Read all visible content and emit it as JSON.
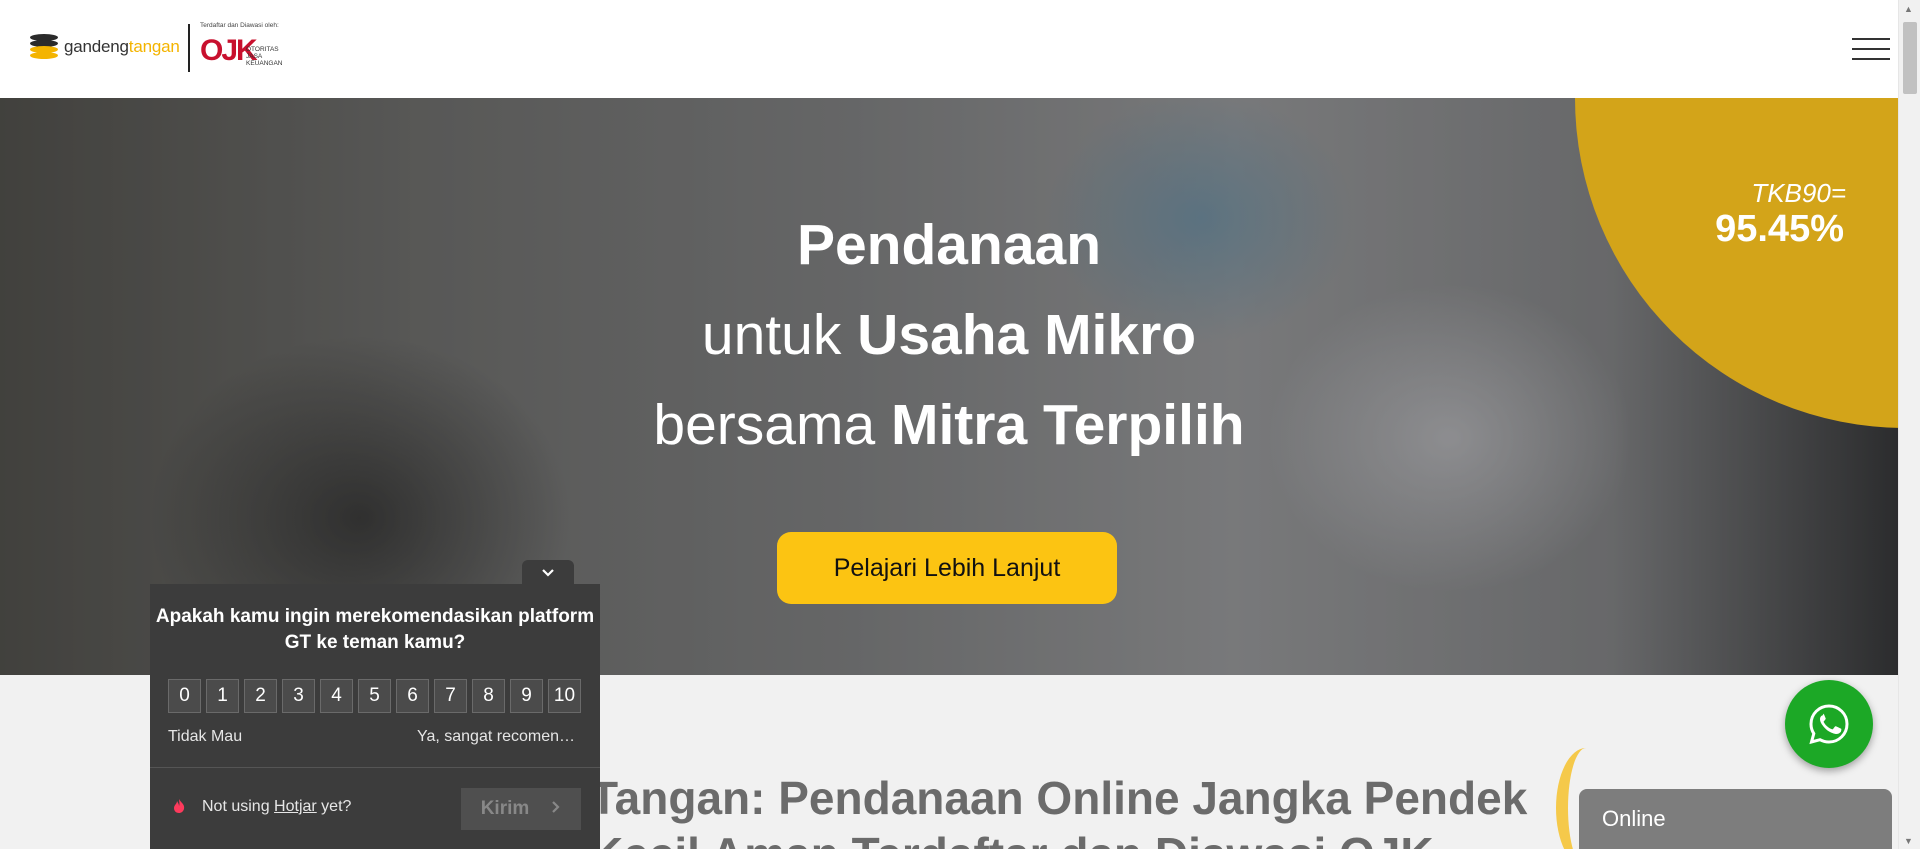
{
  "header": {
    "logo_prefix": "gandeng",
    "logo_suffix": "tangan",
    "ojk_caption": "Terdaftar dan Diawasi oleh:",
    "ojk_mark": "OJK",
    "ojk_line1": "OTORITAS",
    "ojk_line2": "JASA",
    "ojk_line3": "KEUANGAN"
  },
  "hero": {
    "tkb_label": "TKB90=",
    "tkb_value": "95.45%",
    "line1_bold": "Pendanaan",
    "line2_thin": "untuk ",
    "line2_bold": "Usaha Mikro",
    "line3_thin": "bersama ",
    "line3_bold": "Mitra Terpilih",
    "cta_label": "Pelajari Lebih Lanjut"
  },
  "lower": {
    "title_line1": "Tangan: Pendanaan Online Jangka Pendek",
    "title_line2": "Kecil Aman Terdaftar dan Diawasi OJK"
  },
  "survey": {
    "question": "Apakah kamu ingin merekomendasikan platform GT ke teman kamu?",
    "scale": [
      "0",
      "1",
      "2",
      "3",
      "4",
      "5",
      "6",
      "7",
      "8",
      "9",
      "10"
    ],
    "low_label": "Tidak Mau",
    "high_label": "Ya, sangat recomen…",
    "note_prefix": "Not using ",
    "note_link": "Hotjar",
    "note_suffix": " yet?",
    "send_label": "Kirim"
  },
  "chat": {
    "status": "Online"
  },
  "colors": {
    "brand_yellow": "#fcc412",
    "tkb_circle": "#d3a419",
    "whatsapp_green": "#1ca826",
    "survey_bg": "#3c3c3c"
  },
  "icons": [
    "menu-icon",
    "whatsapp-icon",
    "chevron-down-icon",
    "chevron-right-icon",
    "hotjar-flame-icon"
  ]
}
